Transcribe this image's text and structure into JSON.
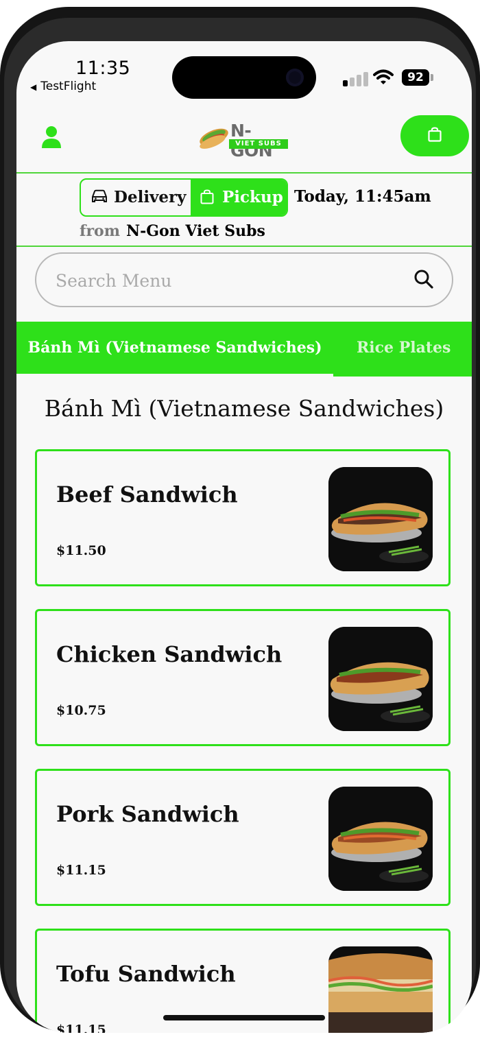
{
  "status_bar": {
    "time": "11:35",
    "back_app": "TestFlight",
    "battery": "92"
  },
  "header": {
    "logo_title": "N-GON",
    "logo_subtitle": "VIET SUBS"
  },
  "order_mode": {
    "delivery_label": "Delivery",
    "pickup_label": "Pickup",
    "selected": "Pickup",
    "time": "Today, 11:45am",
    "from_label": "from",
    "store_name": "N-Gon Viet Subs"
  },
  "search": {
    "placeholder": "Search Menu",
    "value": ""
  },
  "tabs": [
    {
      "label": "Bánh Mì (Vietnamese Sandwiches)",
      "active": true
    },
    {
      "label": "Rice Plates",
      "active": false
    }
  ],
  "section": {
    "title": "Bánh Mì (Vietnamese Sandwiches)"
  },
  "menu_items": [
    {
      "name": "Beef Sandwich",
      "price": "$11.50"
    },
    {
      "name": "Chicken Sandwich",
      "price": "$10.75"
    },
    {
      "name": "Pork Sandwich",
      "price": "$11.15"
    },
    {
      "name": "Tofu Sandwich",
      "price": "$11.15"
    }
  ],
  "colors": {
    "accent": "#2ee01a",
    "background": "#f8f8f8",
    "text": "#111111",
    "muted": "#7a7a7a"
  },
  "icons": [
    "user-icon",
    "shopping-bag-icon",
    "car-icon",
    "search-icon",
    "signal-icon",
    "wifi-icon",
    "battery-icon"
  ]
}
